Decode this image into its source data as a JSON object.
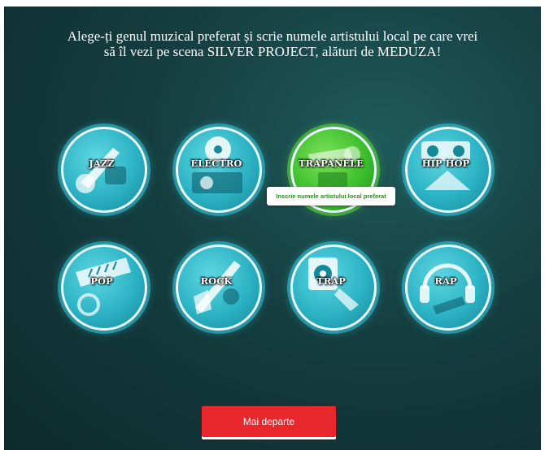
{
  "header": {
    "line1": "Alege-ți genul muzical preferat și scrie numele artistului local pe care vrei",
    "line2": "să îl vezi pe scena SILVER PROJECT, alături de MEDUZA!"
  },
  "genres": [
    {
      "label": "JAZZ",
      "icon": "guitar-icon",
      "selected": false
    },
    {
      "label": "ELECTRO",
      "icon": "turntable-icon",
      "selected": false
    },
    {
      "label": "TRAPANELE",
      "icon": "trumpet-icon",
      "selected": true
    },
    {
      "label": "HIP HOP",
      "icon": "boombox-icon",
      "selected": false
    },
    {
      "label": "POP",
      "icon": "keyboard-icon",
      "selected": false
    },
    {
      "label": "ROCK",
      "icon": "electric-guitar-icon",
      "selected": false
    },
    {
      "label": "TRAP",
      "icon": "speaker-icon",
      "selected": false
    },
    {
      "label": "RAP",
      "icon": "headphones-icon",
      "selected": false
    }
  ],
  "tooltip": {
    "text": "Inscrie numele artistului local preferat"
  },
  "next_button": {
    "label": "Mai departe"
  },
  "colors": {
    "accent": "#e8282c",
    "badge": "#2bb3c4",
    "selected": "#3cbf2c",
    "background": "#153d3f"
  }
}
